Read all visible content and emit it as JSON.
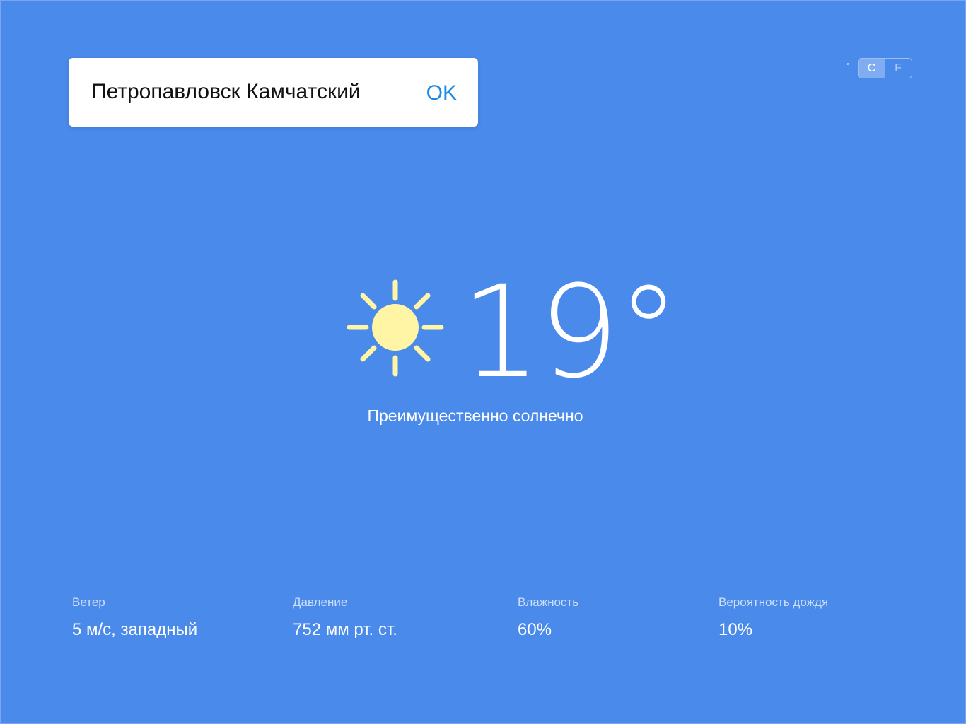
{
  "search": {
    "city_value": "Петропавловск Камчатский",
    "ok_label": "OK"
  },
  "units": {
    "degree_symbol": "°",
    "options": [
      "C",
      "F"
    ],
    "selected": "C"
  },
  "current": {
    "icon": "sun-icon",
    "temperature": "19°",
    "condition": "Преимущественно солнечно",
    "sun_color": "#fff5a5"
  },
  "details": [
    {
      "label": "Ветер",
      "value": "5 м/с, западный"
    },
    {
      "label": "Давление",
      "value": "752 мм рт. ст."
    },
    {
      "label": "Влажность",
      "value": "60%"
    },
    {
      "label": "Вероятность дождя",
      "value": "10%"
    }
  ],
  "colors": {
    "background": "#4a8aeb",
    "accent": "#1e88e5"
  }
}
